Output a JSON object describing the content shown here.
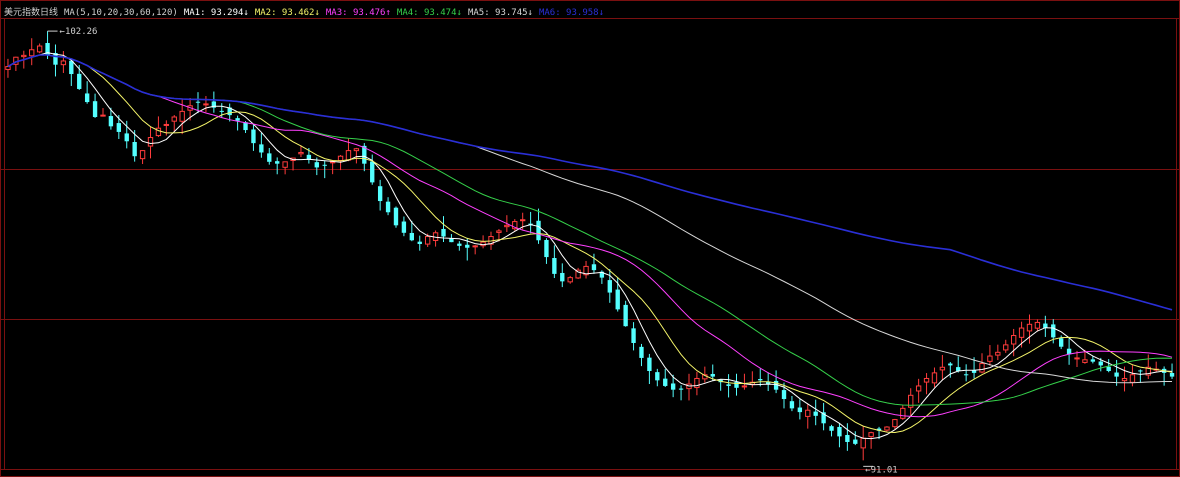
{
  "chart_data": {
    "type": "candlestick",
    "title": "美元指数日线",
    "params_label": "MA(5,10,20,30,60,120)",
    "ylim": [
      90.7,
      102.8
    ],
    "grid": true,
    "high_label": "102.26",
    "low_label": "91.01",
    "ma": [
      {
        "name": "MA1",
        "value": "93.294",
        "arrow": "↓",
        "color": "#ffffff"
      },
      {
        "name": "MA2",
        "value": "93.462",
        "arrow": "↓",
        "color": "#f5f56a"
      },
      {
        "name": "MA3",
        "value": "93.476",
        "arrow": "↑",
        "color": "#ff40ff"
      },
      {
        "name": "MA4",
        "value": "93.474",
        "arrow": "↓",
        "color": "#35d04a"
      },
      {
        "name": "MA5",
        "value": "93.745",
        "arrow": "↓",
        "color": "#d8d8d8"
      },
      {
        "name": "MA6",
        "value": "93.958",
        "arrow": "↓",
        "color": "#2a2fd6"
      }
    ],
    "colors": {
      "up": "#ff3c3c",
      "down": "#54ffff",
      "grid": "#7a1010",
      "background": "#000000"
    },
    "close": [
      101.5,
      101.75,
      101.8,
      101.95,
      102.05,
      101.8,
      101.55,
      101.65,
      101.3,
      100.9,
      100.55,
      100.15,
      100.2,
      99.9,
      99.75,
      99.5,
      99.1,
      99.25,
      99.6,
      99.85,
      99.95,
      100.15,
      100.3,
      100.45,
      100.55,
      100.5,
      100.4,
      100.3,
      100.2,
      100.05,
      99.8,
      99.45,
      99.2,
      98.95,
      98.9,
      98.95,
      99.05,
      99.2,
      99.0,
      98.8,
      98.85,
      98.95,
      99.1,
      99.25,
      99.3,
      98.9,
      98.4,
      97.9,
      97.6,
      97.25,
      97.05,
      96.85,
      96.75,
      96.95,
      97.05,
      96.95,
      96.8,
      96.7,
      96.65,
      96.7,
      96.8,
      96.95,
      97.1,
      97.25,
      97.35,
      97.4,
      97.25,
      96.85,
      96.4,
      95.95,
      95.75,
      95.85,
      96.05,
      96.15,
      96.05,
      95.85,
      95.45,
      95.0,
      94.55,
      94.1,
      93.7,
      93.35,
      93.1,
      92.95,
      92.85,
      92.85,
      93.0,
      93.15,
      93.25,
      93.2,
      93.05,
      92.95,
      92.9,
      92.95,
      93.05,
      93.1,
      93.0,
      92.85,
      92.6,
      92.35,
      92.25,
      92.3,
      92.15,
      91.95,
      91.75,
      91.6,
      91.45,
      91.4,
      91.55,
      91.7,
      91.75,
      91.85,
      92.05,
      92.35,
      92.7,
      92.95,
      93.15,
      93.3,
      93.45,
      93.5,
      93.35,
      93.25,
      93.3,
      93.55,
      93.75,
      93.85,
      94.05,
      94.3,
      94.5,
      94.6,
      94.65,
      94.5,
      94.25,
      94.0,
      93.8,
      93.7,
      93.65,
      93.6,
      93.5,
      93.35,
      93.2,
      93.15,
      93.25,
      93.35,
      93.45,
      93.4,
      93.3,
      93.2
    ]
  }
}
